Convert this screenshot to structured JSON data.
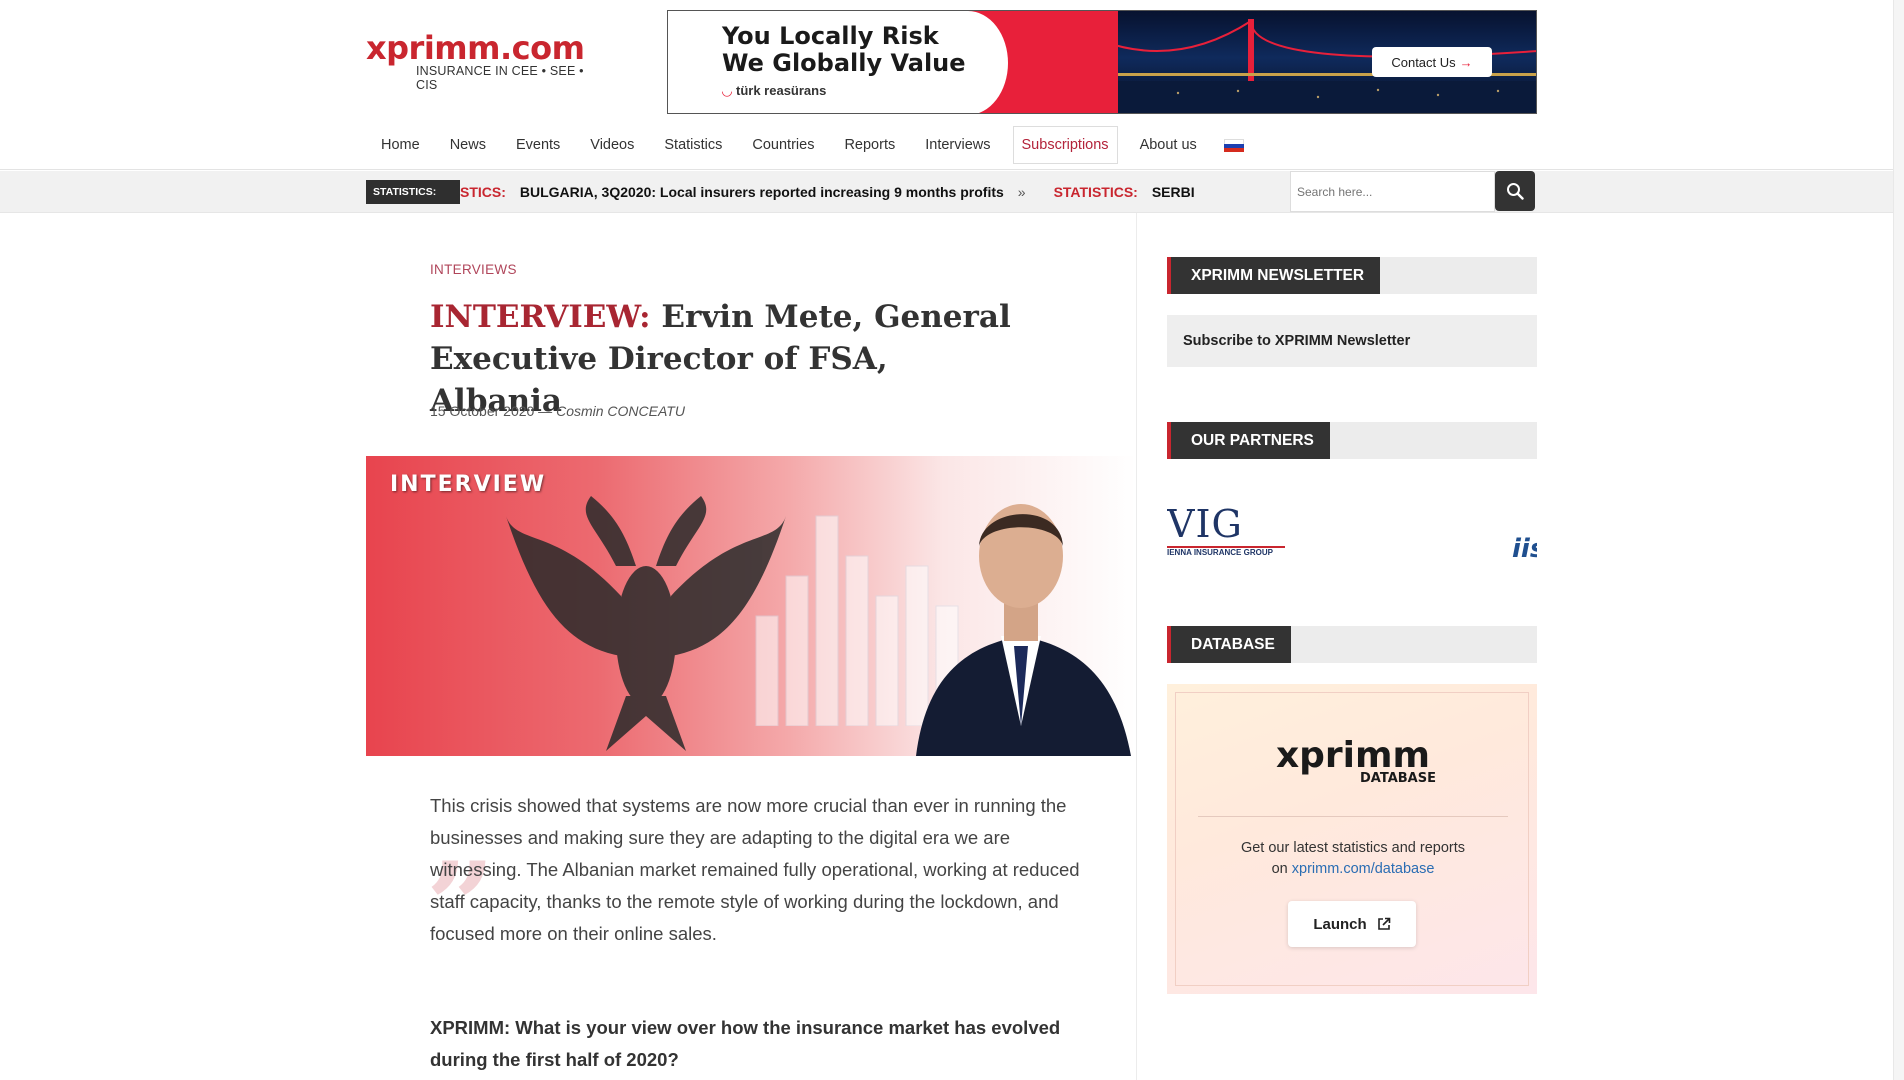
{
  "site": {
    "logo_text": "xprimm.com",
    "logo_tagline": "INSURANCE IN CEE • SEE • CIS"
  },
  "banner": {
    "line1": "You Locally Risk",
    "line2": "We Globally Value",
    "brand": "türk reasürans",
    "cta": "Contact Us"
  },
  "nav": {
    "items": [
      {
        "label": "Home"
      },
      {
        "label": "News"
      },
      {
        "label": "Events"
      },
      {
        "label": "Videos"
      },
      {
        "label": "Statistics"
      },
      {
        "label": "Countries"
      },
      {
        "label": "Reports"
      },
      {
        "label": "Interviews"
      },
      {
        "label": "Subscriptions"
      },
      {
        "label": "About us"
      }
    ],
    "active": "Subscriptions",
    "flag_colors": [
      "#ffffff",
      "#1c3fb0",
      "#d52b1e"
    ]
  },
  "ticker": {
    "label": "STATISTICS:",
    "items": [
      {
        "category": "STICS:",
        "headline": "BULGARIA, 3Q2020: Local insurers reported increasing 9 months profits"
      },
      {
        "category": "STATISTICS:",
        "headline": "SERBI"
      }
    ],
    "separator": "»"
  },
  "search": {
    "placeholder": "Search here..."
  },
  "article": {
    "category": "INTERVIEWS",
    "title_lead": "INTERVIEW:",
    "title_rest": "Ervin Mete, General Executive Director of FSA, Albania",
    "date": "15 October 2020",
    "author": "Cosmin CONCEATU",
    "hero_label": "INTERVIEW",
    "lede": "This crisis showed that systems are now more crucial than ever in running the businesses and making sure they are adapting to the digital era we are witnessing. The Albanian market remained fully operational, working at reduced staff capacity, thanks to the remote style of working during the lockdown, and focused more on their online sales.",
    "question": "XPRIMM: What is your view over how the insurance market has evolved during the first half of 2020?"
  },
  "sidebar": {
    "newsletter_title": "XPRIMM NEWSLETTER",
    "newsletter_cta": "Subscribe to XPRIMM Newsletter",
    "partners_title": "OUR PARTNERS",
    "partner1_name": "VIG",
    "partner1_sub": "IENNA INSURANCE GROUP",
    "partner2_fragment": "iis",
    "database_title": "DATABASE",
    "db_logo": "xprimm",
    "db_logo_sub": "DATABASE",
    "db_text": "Get our latest statistics and reports",
    "db_text_prefix": "on",
    "db_link": "xprimm.com/database",
    "launch_label": "Launch"
  },
  "colors": {
    "brand_red": "#c9262f",
    "banner_red": "#e8203a",
    "link_blue": "#2a6db3",
    "dark": "#333333"
  }
}
